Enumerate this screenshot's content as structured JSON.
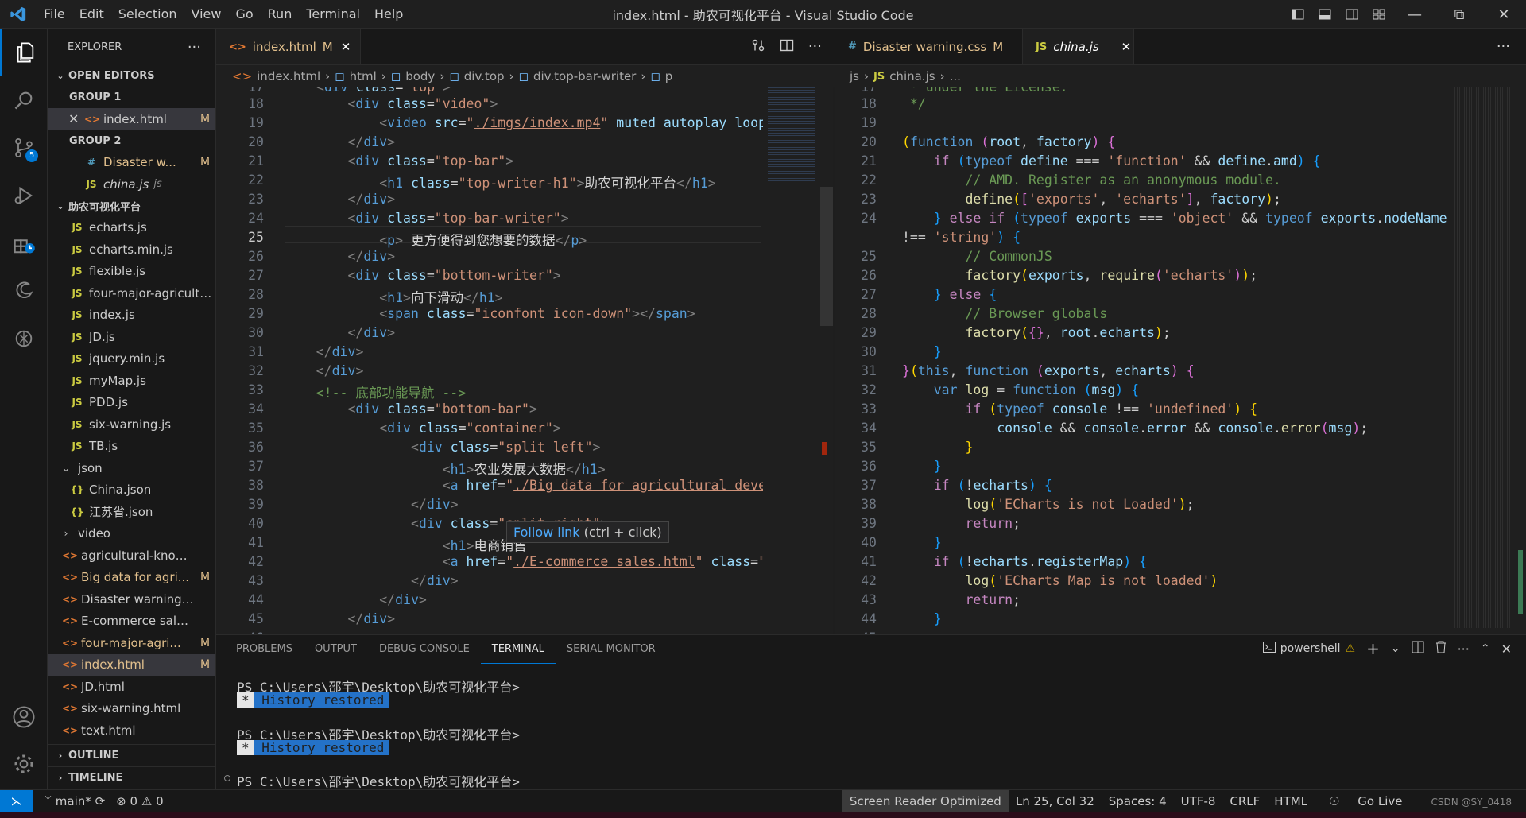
{
  "window": {
    "title": "index.html - 助农可视化平台 - Visual Studio Code",
    "menu": [
      "File",
      "Edit",
      "Selection",
      "View",
      "Go",
      "Run",
      "Terminal",
      "Help"
    ]
  },
  "activity": {
    "scm_badge": "5"
  },
  "sidebar": {
    "title": "EXPLORER",
    "open_editors": "OPEN EDITORS",
    "group1": "GROUP 1",
    "group1_file": "index.html",
    "group1_status": "M",
    "group2": "GROUP 2",
    "group2_files": [
      {
        "name": "Disaster w...",
        "status": "M"
      },
      {
        "name": "china.js",
        "suffix": "js"
      }
    ],
    "project": "助农可视化平台",
    "files": [
      {
        "name": "echarts.js",
        "type": "js"
      },
      {
        "name": "echarts.min.js",
        "type": "js"
      },
      {
        "name": "flexible.js",
        "type": "js"
      },
      {
        "name": "four-major-agricultu...",
        "type": "js"
      },
      {
        "name": "index.js",
        "type": "js"
      },
      {
        "name": "JD.js",
        "type": "js"
      },
      {
        "name": "jquery.min.js",
        "type": "js"
      },
      {
        "name": "myMap.js",
        "type": "js"
      },
      {
        "name": "PDD.js",
        "type": "js"
      },
      {
        "name": "six-warning.js",
        "type": "js"
      },
      {
        "name": "TB.js",
        "type": "js"
      }
    ],
    "json_folder": "json",
    "json_files": [
      "China.json",
      "江苏省.json"
    ],
    "video_folder": "video",
    "html_files": [
      {
        "name": "agricultural-knowled...",
        "status": ""
      },
      {
        "name": "Big data for agri...",
        "status": "M"
      },
      {
        "name": "Disaster warning.html",
        "status": ""
      },
      {
        "name": "E-commerce sales.html",
        "status": ""
      },
      {
        "name": "four-major-agri...",
        "status": "M"
      },
      {
        "name": "index.html",
        "status": "M"
      },
      {
        "name": "JD.html",
        "status": ""
      },
      {
        "name": "six-warning.html",
        "status": ""
      },
      {
        "name": "text.html",
        "status": ""
      }
    ],
    "outline": "OUTLINE",
    "timeline": "TIMELINE"
  },
  "left_editor": {
    "tab": "index.html",
    "tab_status": "M",
    "breadcrumbs": [
      "index.html",
      "html",
      "body",
      "div.top",
      "div.top-bar-writer",
      "p"
    ]
  },
  "right_editor": {
    "tab1": "Disaster warning.css",
    "tab1_status": "M",
    "tab2": "china.js",
    "breadcrumbs": [
      "js",
      "china.js",
      "..."
    ]
  },
  "hover": {
    "link": "Follow link",
    "hint": "(ctrl + click)"
  },
  "panel": {
    "tabs": [
      "PROBLEMS",
      "OUTPUT",
      "DEBUG CONSOLE",
      "TERMINAL",
      "SERIAL MONITOR"
    ],
    "active_tab": "TERMINAL",
    "shell": "powershell",
    "prompt": "PS C:\\Users\\邵宇\\Desktop\\助农可视化平台>",
    "history": "History restored",
    "star": "*"
  },
  "status": {
    "branch": "main*",
    "errors": "0",
    "warnings": "0",
    "screen_reader": "Screen Reader Optimized",
    "position": "Ln 25, Col 32",
    "spaces": "Spaces: 4",
    "encoding": "UTF-8",
    "eol": "CRLF",
    "language": "HTML",
    "golive": "Go Live",
    "watermark": "CSDN @SY_0418"
  }
}
